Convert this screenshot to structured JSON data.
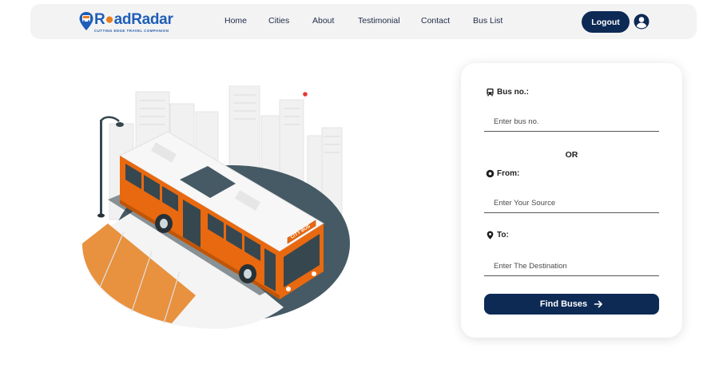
{
  "brand": {
    "logo_text_1": "R",
    "logo_text_2": "ad",
    "logo_text_3": "Radar",
    "tagline": "CUTTING EDGE TRAVEL COMPANION"
  },
  "nav": {
    "links": [
      "Home",
      "Cities",
      "About",
      "Testimonial",
      "Contact",
      "Bus List"
    ],
    "logout_label": "Logout"
  },
  "form": {
    "bus_no_label": "Bus no.:",
    "bus_no_placeholder": "Enter bus no.",
    "or_text": "OR",
    "from_label": "From:",
    "from_placeholder": "Enter Your Source",
    "to_label": "To:",
    "to_placeholder": "Enter The Destination",
    "submit_label": "Find Buses"
  },
  "illustration": {
    "bus_sign": "CITY BUS"
  },
  "colors": {
    "primary": "#0d2a55",
    "brand_blue": "#1e5eb8",
    "brand_orange": "#e87d1e",
    "bus_orange": "#e8690f",
    "road_dark": "#455a64"
  }
}
